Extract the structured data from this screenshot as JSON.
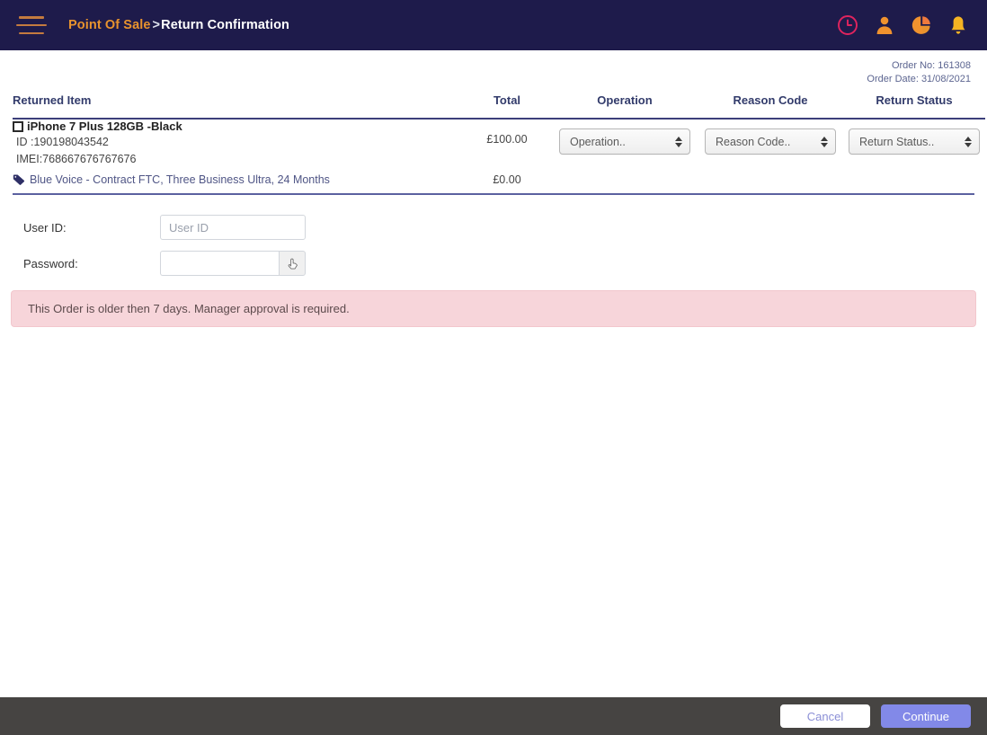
{
  "topbar": {
    "menu_icon": "hamburger-icon",
    "breadcrumb_root": "Point Of Sale",
    "breadcrumb_separator": ">",
    "breadcrumb_leaf": "Return Confirmation",
    "icons": [
      {
        "name": "clock-icon",
        "color": "#e0245e"
      },
      {
        "name": "user-icon",
        "color": "#f0922e"
      },
      {
        "name": "pie-chart-icon",
        "color": "#f0922e"
      },
      {
        "name": "bell-icon",
        "color": "#f5b423"
      }
    ],
    "background": "#1e1b4b",
    "accent": "#e8932e"
  },
  "order": {
    "number_label": "Order No: 161308",
    "date_label": "Order Date: 31/08/2021"
  },
  "table": {
    "headers": {
      "item": "Returned Item",
      "total": "Total",
      "operation": "Operation",
      "reason": "Reason Code",
      "status": "Return Status"
    },
    "rows": [
      {
        "checkbox_checked": false,
        "name": "iPhone 7 Plus 128GB -Black",
        "id_line": "ID :190198043542",
        "imei_line": "IMEI:768667676767676",
        "total": "£100.00",
        "operation": "Operation..",
        "reason": "Reason Code..",
        "status": "Return Status.."
      }
    ],
    "bundle": {
      "icon": "tag-icon",
      "name": "Blue Voice - Contract FTC, Three Business Ultra, 24 Months",
      "total": "£0.00"
    }
  },
  "form": {
    "user_id_label": "User ID:",
    "user_id_value": "",
    "user_id_placeholder": "User ID",
    "password_label": "Password:",
    "password_value": "",
    "password_placeholder": "",
    "password_button_icon": "hand-pointer-icon"
  },
  "alert": {
    "message": "This Order is older then 7 days. Manager approval is required.",
    "background": "#f7d5da"
  },
  "footer": {
    "cancel_label": "Cancel",
    "continue_label": "Continue",
    "background": "#464442",
    "primary_color": "#8289e8"
  }
}
